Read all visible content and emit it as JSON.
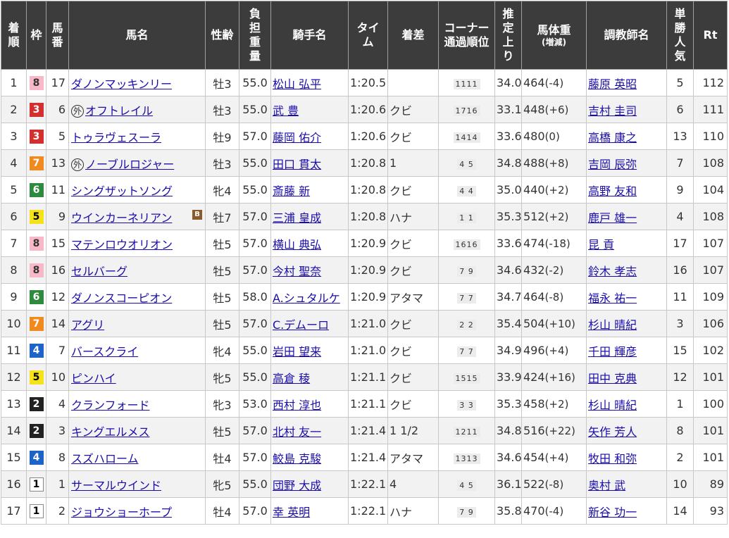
{
  "headers": {
    "rank": "着順",
    "waku": "枠",
    "umaban": "馬番",
    "name": "馬名",
    "sexage": "性齢",
    "weight": "負担重量",
    "jockey": "騎手名",
    "time": "タイム",
    "margin": "着差",
    "corner": "コーナー通過順位",
    "last3f": "推定上り",
    "body": "馬体重",
    "body_sub": "(増減)",
    "trainer": "調教師名",
    "pop": "単勝人気",
    "rt": "Rt"
  },
  "colors": {
    "header_bg": "#3c3c3c",
    "link": "#1a0dab",
    "blinker_bg": "#8b5a2b"
  },
  "gai_mark": "外",
  "blinker_mark": "B",
  "rows": [
    {
      "rank": "1",
      "waku": "8",
      "umaban": "17",
      "name": "ダノンマッキンリー",
      "gai": false,
      "blinker": false,
      "sexage": "牡3",
      "weight": "55.0",
      "jockey": "松山 弘平",
      "time": "1:20.5",
      "margin": "",
      "corner": "1111",
      "last3f": "34.0",
      "body": "464",
      "diff": "(-4)",
      "trainer": "藤原 英昭",
      "pop": "5",
      "rt": "112"
    },
    {
      "rank": "2",
      "waku": "3",
      "umaban": "6",
      "name": "オフトレイル",
      "gai": true,
      "blinker": false,
      "sexage": "牡3",
      "weight": "55.0",
      "jockey": "武 豊",
      "time": "1:20.6",
      "margin": "クビ",
      "corner": "1716",
      "last3f": "33.1",
      "body": "448",
      "diff": "(+6)",
      "trainer": "吉村 圭司",
      "pop": "6",
      "rt": "111"
    },
    {
      "rank": "3",
      "waku": "3",
      "umaban": "5",
      "name": "トゥラヴェスーラ",
      "gai": false,
      "blinker": false,
      "sexage": "牡9",
      "weight": "57.0",
      "jockey": "藤岡 佑介",
      "time": "1:20.6",
      "margin": "クビ",
      "corner": "1414",
      "last3f": "33.6",
      "body": "480",
      "diff": "(0)",
      "trainer": "高橋 康之",
      "pop": "13",
      "rt": "110"
    },
    {
      "rank": "4",
      "waku": "7",
      "umaban": "13",
      "name": "ノーブルロジャー",
      "gai": true,
      "blinker": false,
      "sexage": "牡3",
      "weight": "55.0",
      "jockey": "田口 貫太",
      "time": "1:20.8",
      "margin": "1",
      "corner": "4 5",
      "last3f": "34.8",
      "body": "488",
      "diff": "(+8)",
      "trainer": "吉岡 辰弥",
      "pop": "7",
      "rt": "108"
    },
    {
      "rank": "5",
      "waku": "6",
      "umaban": "11",
      "name": "シングザットソング",
      "gai": false,
      "blinker": false,
      "sexage": "牝4",
      "weight": "55.0",
      "jockey": "斎藤 新",
      "time": "1:20.8",
      "margin": "クビ",
      "corner": "4 4",
      "last3f": "35.0",
      "body": "440",
      "diff": "(+2)",
      "trainer": "高野 友和",
      "pop": "9",
      "rt": "104"
    },
    {
      "rank": "6",
      "waku": "5",
      "umaban": "9",
      "name": "ウインカーネリアン",
      "gai": false,
      "blinker": true,
      "sexage": "牡7",
      "weight": "57.0",
      "jockey": "三浦 皇成",
      "time": "1:20.8",
      "margin": "ハナ",
      "corner": "1 1",
      "last3f": "35.3",
      "body": "512",
      "diff": "(+2)",
      "trainer": "鹿戸 雄一",
      "pop": "4",
      "rt": "108"
    },
    {
      "rank": "7",
      "waku": "8",
      "umaban": "15",
      "name": "マテンロウオリオン",
      "gai": false,
      "blinker": false,
      "sexage": "牡5",
      "weight": "57.0",
      "jockey": "横山 典弘",
      "time": "1:20.9",
      "margin": "クビ",
      "corner": "1616",
      "last3f": "33.6",
      "body": "474",
      "diff": "(-18)",
      "trainer": "昆 貢",
      "pop": "17",
      "rt": "107"
    },
    {
      "rank": "8",
      "waku": "8",
      "umaban": "16",
      "name": "セルバーグ",
      "gai": false,
      "blinker": false,
      "sexage": "牡5",
      "weight": "57.0",
      "jockey": "今村 聖奈",
      "time": "1:20.9",
      "margin": "クビ",
      "corner": "7 9",
      "last3f": "34.6",
      "body": "432",
      "diff": "(-2)",
      "trainer": "鈴木 孝志",
      "pop": "16",
      "rt": "107"
    },
    {
      "rank": "9",
      "waku": "6",
      "umaban": "12",
      "name": "ダノンスコーピオン",
      "gai": false,
      "blinker": false,
      "sexage": "牡5",
      "weight": "58.0",
      "jockey": "A.シュタルケ",
      "time": "1:20.9",
      "margin": "アタマ",
      "corner": "7 7",
      "last3f": "34.7",
      "body": "464",
      "diff": "(-8)",
      "trainer": "福永 祐一",
      "pop": "11",
      "rt": "109"
    },
    {
      "rank": "10",
      "waku": "7",
      "umaban": "14",
      "name": "アグリ",
      "gai": false,
      "blinker": false,
      "sexage": "牡5",
      "weight": "57.0",
      "jockey": "C.デムーロ",
      "time": "1:21.0",
      "margin": "クビ",
      "corner": "2 2",
      "last3f": "35.4",
      "body": "504",
      "diff": "(+10)",
      "trainer": "杉山 晴紀",
      "pop": "3",
      "rt": "106"
    },
    {
      "rank": "11",
      "waku": "4",
      "umaban": "7",
      "name": "バースクライ",
      "gai": false,
      "blinker": false,
      "sexage": "牝4",
      "weight": "55.0",
      "jockey": "岩田 望来",
      "time": "1:21.0",
      "margin": "クビ",
      "corner": "7 7",
      "last3f": "34.9",
      "body": "496",
      "diff": "(+4)",
      "trainer": "千田 輝彦",
      "pop": "15",
      "rt": "102"
    },
    {
      "rank": "12",
      "waku": "5",
      "umaban": "10",
      "name": "ピンハイ",
      "gai": false,
      "blinker": false,
      "sexage": "牝5",
      "weight": "55.0",
      "jockey": "高倉 稜",
      "time": "1:21.1",
      "margin": "クビ",
      "corner": "1515",
      "last3f": "33.9",
      "body": "424",
      "diff": "(+16)",
      "trainer": "田中 克典",
      "pop": "12",
      "rt": "101"
    },
    {
      "rank": "13",
      "waku": "2",
      "umaban": "4",
      "name": "クランフォード",
      "gai": false,
      "blinker": false,
      "sexage": "牝3",
      "weight": "53.0",
      "jockey": "西村 淳也",
      "time": "1:21.1",
      "margin": "クビ",
      "corner": "3 3",
      "last3f": "35.3",
      "body": "458",
      "diff": "(+2)",
      "trainer": "杉山 晴紀",
      "pop": "1",
      "rt": "100"
    },
    {
      "rank": "14",
      "waku": "2",
      "umaban": "3",
      "name": "キングエルメス",
      "gai": false,
      "blinker": false,
      "sexage": "牡5",
      "weight": "57.0",
      "jockey": "北村 友一",
      "time": "1:21.4",
      "margin": "1 1/2",
      "corner": "1211",
      "last3f": "34.8",
      "body": "516",
      "diff": "(+22)",
      "trainer": "矢作 芳人",
      "pop": "8",
      "rt": "101"
    },
    {
      "rank": "15",
      "waku": "4",
      "umaban": "8",
      "name": "スズハローム",
      "gai": false,
      "blinker": false,
      "sexage": "牡4",
      "weight": "57.0",
      "jockey": "鮫島 克駿",
      "time": "1:21.4",
      "margin": "アタマ",
      "corner": "1313",
      "last3f": "34.6",
      "body": "454",
      "diff": "(+4)",
      "trainer": "牧田 和弥",
      "pop": "2",
      "rt": "101"
    },
    {
      "rank": "16",
      "waku": "1",
      "umaban": "1",
      "name": "サーマルウインド",
      "gai": false,
      "blinker": false,
      "sexage": "牝5",
      "weight": "55.0",
      "jockey": "団野 大成",
      "time": "1:22.1",
      "margin": "4",
      "corner": "4 5",
      "last3f": "36.1",
      "body": "522",
      "diff": "(-8)",
      "trainer": "奥村 武",
      "pop": "10",
      "rt": "89"
    },
    {
      "rank": "17",
      "waku": "1",
      "umaban": "2",
      "name": "ジョウショーホープ",
      "gai": false,
      "blinker": false,
      "sexage": "牡4",
      "weight": "57.0",
      "jockey": "幸 英明",
      "time": "1:22.1",
      "margin": "ハナ",
      "corner": "7 9",
      "last3f": "35.8",
      "body": "470",
      "diff": "(-4)",
      "trainer": "新谷 功一",
      "pop": "14",
      "rt": "93"
    }
  ]
}
